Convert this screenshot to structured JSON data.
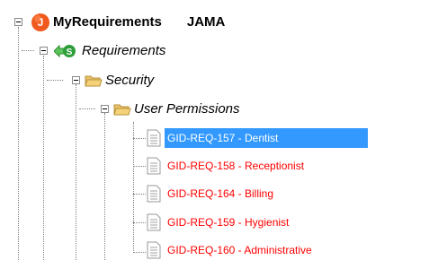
{
  "tree": {
    "root": {
      "label": "MyRequirements",
      "suffix": "JAMA",
      "icon": "project-icon",
      "icon_letter": "J",
      "icon_color": "#f05a1e"
    },
    "requirements": {
      "label": "Requirements",
      "icon": "set-icon",
      "icon_letter": "S",
      "icon_color": "#2e9e3a"
    },
    "security": {
      "label": "Security",
      "icon": "folder-icon"
    },
    "user_permissions": {
      "label": "User Permissions",
      "icon": "folder-icon"
    },
    "items": [
      {
        "label": "GID-REQ-157 - Dentist",
        "selected": true
      },
      {
        "label": "GID-REQ-158 - Receptionist",
        "selected": false
      },
      {
        "label": "GID-REQ-164 - Billing",
        "selected": false
      },
      {
        "label": "GID-REQ-159 - Hygienist",
        "selected": false
      },
      {
        "label": "GID-REQ-160 - Administrative",
        "selected": false
      }
    ],
    "colors": {
      "item_text": "#ff0000",
      "selection_bg": "#3399ff",
      "folder": "#f5d27a"
    }
  }
}
